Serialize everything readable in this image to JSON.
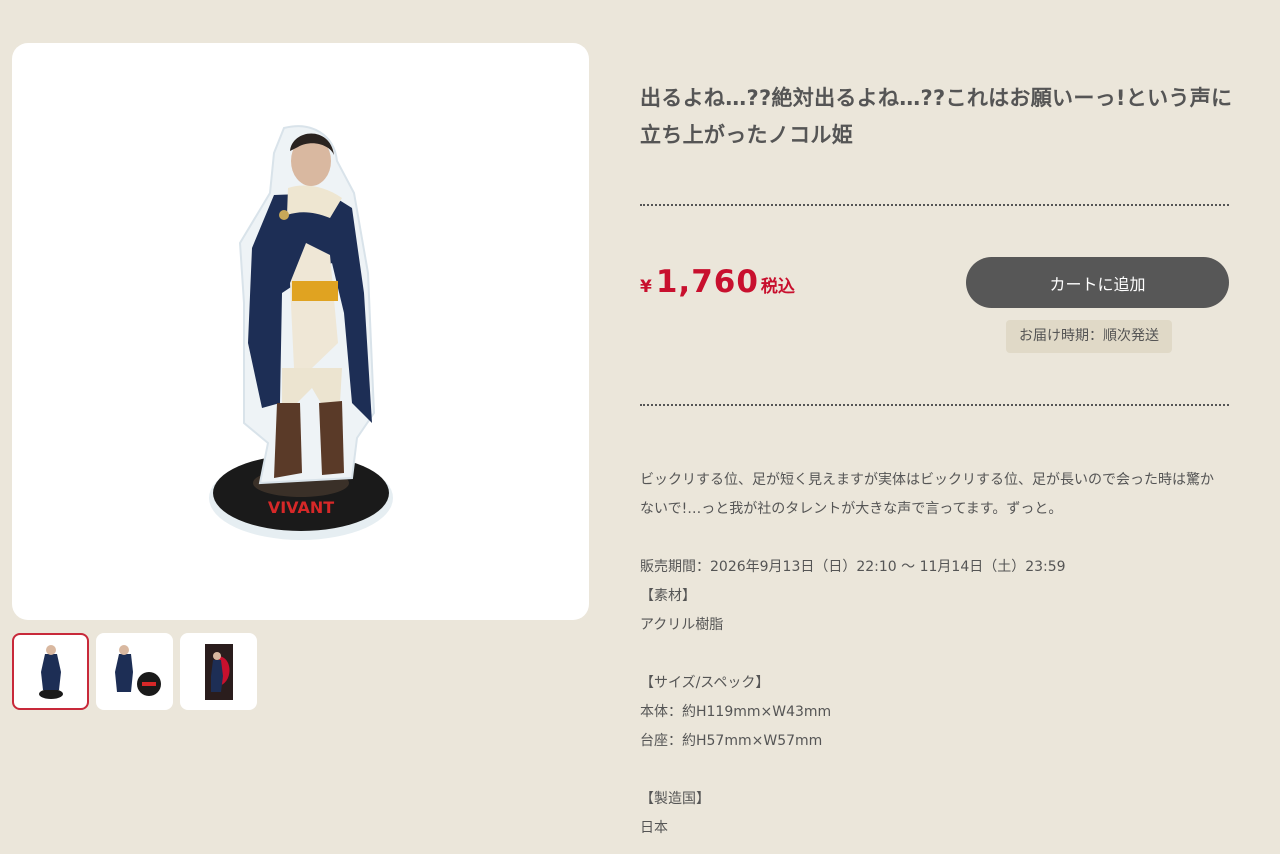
{
  "product": {
    "title_line1": "出るよね…??絶対出るよね…??これはお願いーっ!という声に",
    "title_line2": "立ち上がったノコル姫",
    "main_image_logo_text": "VIVANT",
    "main_image_icon": "acrylic-stand-figure",
    "thumbnails": [
      {
        "icon": "stand-front-thumbnail",
        "active": true
      },
      {
        "icon": "stand-with-base-thumbnail",
        "active": false
      },
      {
        "icon": "package-thumbnail",
        "active": false
      }
    ]
  },
  "price": {
    "currency": "¥",
    "amount": "1,760",
    "tax_label": "税込",
    "color": "#c8102e"
  },
  "actions": {
    "cart_label": "カートに追加",
    "delivery_label": "お届け時期：順次発送"
  },
  "description": {
    "line1": "ビックリする位、足が短く見えますが実体はビックリする位、足が長いので会った時は驚か",
    "line2": "ないで!…っと我が社のタレントが大きな声で言ってます。ずっと。",
    "sale_period": "販売期間：2026年9月13日（日）22:10 〜 11月14日（土）23:59",
    "material_heading": "【素材】",
    "material": "アクリル樹脂",
    "size_heading": "【サイズ/スペック】",
    "size_body": "本体：約H119mm×W43mm",
    "size_base": "台座：約H57mm×W57mm",
    "country_heading": "【製造国】",
    "country": "日本"
  }
}
